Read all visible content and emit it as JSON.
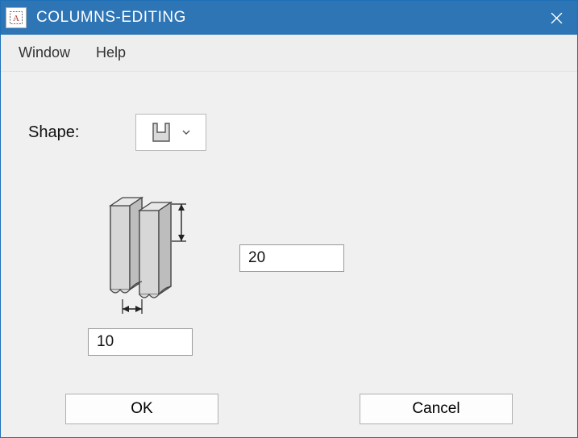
{
  "title": "COLUMNS-EDITING",
  "menu": {
    "window": "Window",
    "help": "Help"
  },
  "shape_label": "Shape:",
  "inputs": {
    "height": "20",
    "width": "10"
  },
  "buttons": {
    "ok": "OK",
    "cancel": "Cancel"
  }
}
